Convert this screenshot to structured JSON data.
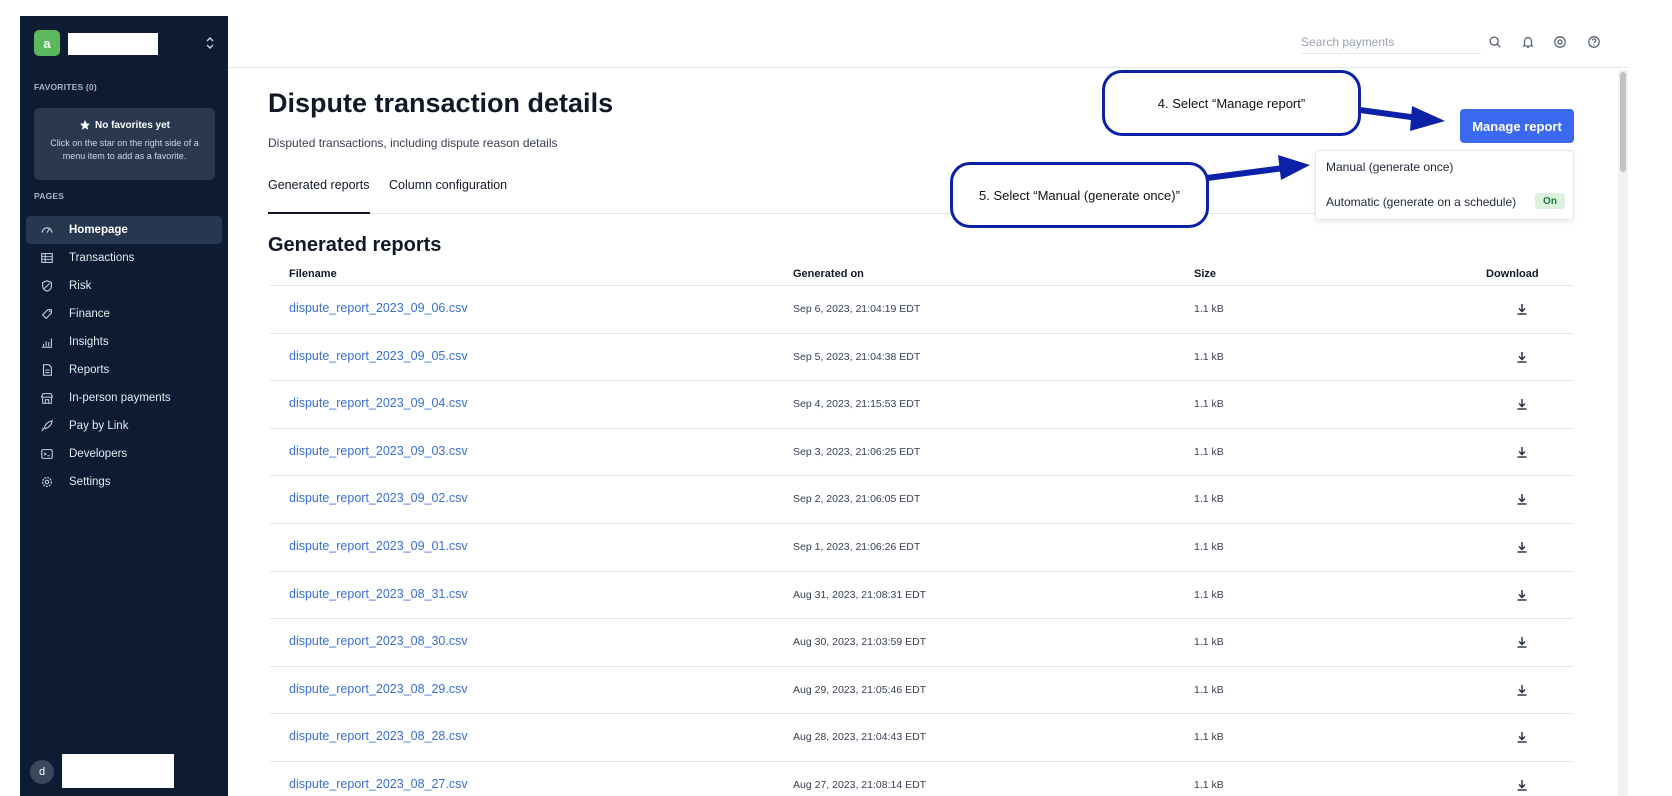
{
  "colors": {
    "sidebar": "#0d1b33",
    "accent": "#3b6af0",
    "link": "#3b6ed6",
    "annotation": "#0b21a8",
    "badge_bg": "#dcf2df",
    "badge_text": "#1e7b34"
  },
  "sidebar": {
    "logo_letter": "a",
    "favorites_label": "FAVORITES (0)",
    "no_favorites_title": "No favorites yet",
    "no_favorites_desc": "Click on the star on the right side of a menu item to add as a favorite.",
    "pages_label": "PAGES",
    "items": [
      {
        "label": "Homepage",
        "icon": "gauge-icon"
      },
      {
        "label": "Transactions",
        "icon": "table-icon"
      },
      {
        "label": "Risk",
        "icon": "shield-icon"
      },
      {
        "label": "Finance",
        "icon": "tag-icon"
      },
      {
        "label": "Insights",
        "icon": "bar-chart-icon"
      },
      {
        "label": "Reports",
        "icon": "document-icon"
      },
      {
        "label": "In-person payments",
        "icon": "store-icon"
      },
      {
        "label": "Pay by Link",
        "icon": "rocket-icon"
      },
      {
        "label": "Developers",
        "icon": "terminal-icon"
      },
      {
        "label": "Settings",
        "icon": "gear-icon"
      }
    ],
    "user_initial": "d"
  },
  "topbar": {
    "search_placeholder": "Search payments"
  },
  "page": {
    "title": "Dispute transaction details",
    "subtitle": "Disputed transactions, including dispute reason details",
    "tabs": [
      "Generated reports",
      "Column configuration"
    ],
    "manage_button": "Manage report",
    "dropdown": {
      "manual": "Manual (generate once)",
      "automatic": "Automatic (generate on a schedule)",
      "badge": "On"
    },
    "section_title": "Generated reports"
  },
  "table": {
    "headers": {
      "filename": "Filename",
      "generated": "Generated on",
      "size": "Size",
      "download": "Download"
    },
    "rows": [
      {
        "file": "dispute_report_2023_09_06.csv",
        "date": "Sep 6, 2023, 21:04:19 EDT",
        "size": "1.1 kB"
      },
      {
        "file": "dispute_report_2023_09_05.csv",
        "date": "Sep 5, 2023, 21:04:38 EDT",
        "size": "1.1 kB"
      },
      {
        "file": "dispute_report_2023_09_04.csv",
        "date": "Sep 4, 2023, 21:15:53 EDT",
        "size": "1.1 kB"
      },
      {
        "file": "dispute_report_2023_09_03.csv",
        "date": "Sep 3, 2023, 21:06:25 EDT",
        "size": "1.1 kB"
      },
      {
        "file": "dispute_report_2023_09_02.csv",
        "date": "Sep 2, 2023, 21:06:05 EDT",
        "size": "1.1 kB"
      },
      {
        "file": "dispute_report_2023_09_01.csv",
        "date": "Sep 1, 2023, 21:06:26 EDT",
        "size": "1.1 kB"
      },
      {
        "file": "dispute_report_2023_08_31.csv",
        "date": "Aug 31, 2023, 21:08:31 EDT",
        "size": "1.1 kB"
      },
      {
        "file": "dispute_report_2023_08_30.csv",
        "date": "Aug 30, 2023, 21:03:59 EDT",
        "size": "1.1 kB"
      },
      {
        "file": "dispute_report_2023_08_29.csv",
        "date": "Aug 29, 2023, 21:05:46 EDT",
        "size": "1.1 kB"
      },
      {
        "file": "dispute_report_2023_08_28.csv",
        "date": "Aug 28, 2023, 21:04:43 EDT",
        "size": "1.1 kB"
      },
      {
        "file": "dispute_report_2023_08_27.csv",
        "date": "Aug 27, 2023, 21:08:14 EDT",
        "size": "1.1 kB"
      }
    ]
  },
  "annotations": {
    "step4": "4. Select “Manage report”",
    "step5": "5. Select “Manual (generate once)”"
  }
}
